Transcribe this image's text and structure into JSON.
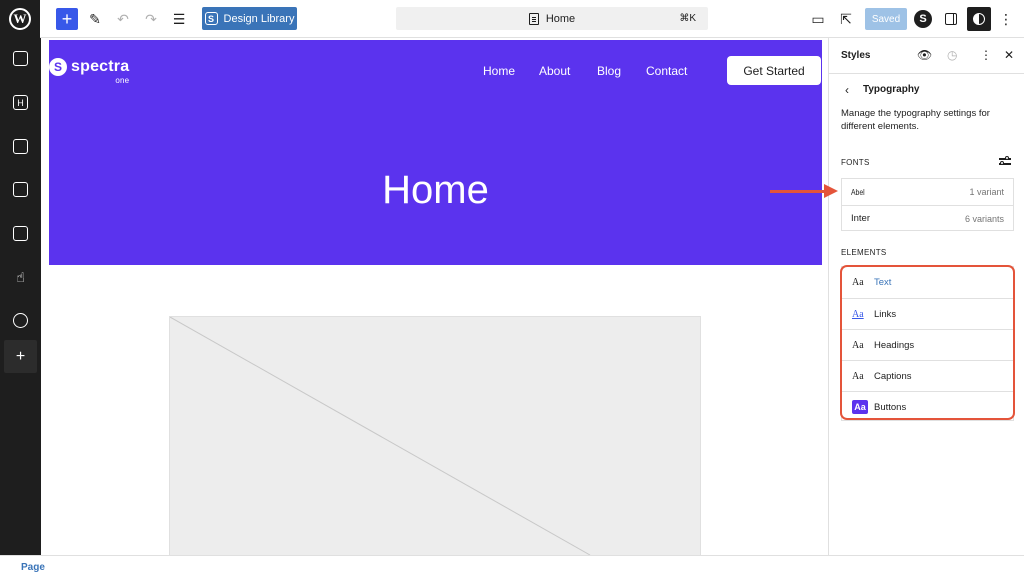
{
  "toolbar": {
    "design_library_label": "Design Library",
    "document_title": "Home",
    "command_shortcut": "⌘K",
    "saved_label": "Saved"
  },
  "hero": {
    "logo_word": "spectra",
    "logo_sub": "one",
    "nav": [
      "Home",
      "About",
      "Blog",
      "Contact"
    ],
    "cta_label": "Get Started",
    "title": "Home"
  },
  "panel": {
    "title": "Styles",
    "section_title": "Typography",
    "description": "Manage the typography settings for different elements.",
    "fonts_label": "FONTS",
    "fonts": [
      {
        "name": "Abel",
        "meta": "1 variant"
      },
      {
        "name": "Inter",
        "meta": "6 variants"
      }
    ],
    "elements_label": "ELEMENTS",
    "elements": [
      {
        "sample": "Aa",
        "label": "Text"
      },
      {
        "sample": "Aa",
        "label": "Links"
      },
      {
        "sample": "Aa",
        "label": "Headings"
      },
      {
        "sample": "Aa",
        "label": "Captions"
      },
      {
        "sample": "Aa",
        "label": "Buttons"
      }
    ]
  },
  "footer": {
    "breadcrumb": "Page"
  },
  "colors": {
    "hero_bg": "#5b33ee",
    "accent": "#3858e9",
    "annotation": "#e4543a"
  },
  "icons": [
    "wordpress-logo-icon",
    "plus-icon",
    "pen-icon",
    "undo-icon",
    "redo-icon",
    "list-view-icon",
    "spectra-icon",
    "document-icon",
    "device-preview-icon",
    "external-link-icon",
    "sidebar-toggle-icon",
    "styles-icon",
    "more-vertical-icon",
    "eye-icon",
    "history-icon",
    "close-icon",
    "chevron-left-icon",
    "adjust-icon"
  ]
}
